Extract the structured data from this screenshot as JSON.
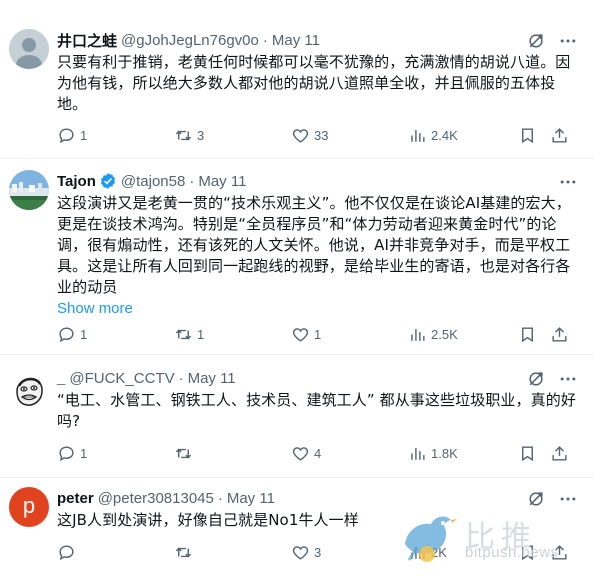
{
  "tweets": [
    {
      "name": "井口之蛙",
      "handle": "@gJohJegLn76gv0o",
      "date": "May 11",
      "text": "只要有利于推销，老黄任何时候都可以毫不犹豫的，充满激情的胡说八道。因为他有钱，所以绝大多数人都对他的胡说八道照单全收，并且佩服的五体投地。",
      "replies": "1",
      "reposts": "3",
      "likes": "33",
      "views": "2.4K",
      "avatar": "default-avatar"
    },
    {
      "name": "Tajon",
      "handle": "@tajon58",
      "date": "May 11",
      "verified": true,
      "text": "这段演讲又是老黄一贯的“技术乐观主义”。他不仅仅是在谈论AI基建的宏大，更是在谈技术鸿沟。特别是“全员程序员”和“体力劳动者迎来黄金时代”的论调，很有煽动性，还有该死的人文关怀。他说，AI并非竞争对手，而是平权工具。这是让所有人回到同一起跑线的视野，是给毕业生的寄语，也是对各行各业的动员",
      "show_more": "Show more",
      "replies": "1",
      "reposts": "1",
      "likes": "1",
      "views": "2.5K",
      "avatar": "landscape-avatar"
    },
    {
      "name": "_",
      "handle": "@FUCK_CCTV",
      "date": "May 11",
      "text": "“电工、水管工、钢铁工人、技术员、建筑工人” 都从事这些垃圾职业，真的好吗?",
      "replies": "1",
      "reposts": "",
      "likes": "4",
      "views": "1.8K",
      "avatar": "meme-face-avatar"
    },
    {
      "name": "peter",
      "handle": "@peter30813045",
      "date": "May 11",
      "text": "这JB人到处演讲，好像自己就是No1牛人一样",
      "replies": "",
      "reposts": "",
      "likes": "3",
      "views": "2K",
      "avatar_letter": "p",
      "avatar_color": "#e0441f"
    }
  ],
  "watermark": {
    "title": "比推",
    "subtitle": "bitpush.news"
  },
  "colors": {
    "text": "#0f1419",
    "secondary": "#536471",
    "link": "#1d9bf0",
    "divider": "#eff3f4"
  }
}
